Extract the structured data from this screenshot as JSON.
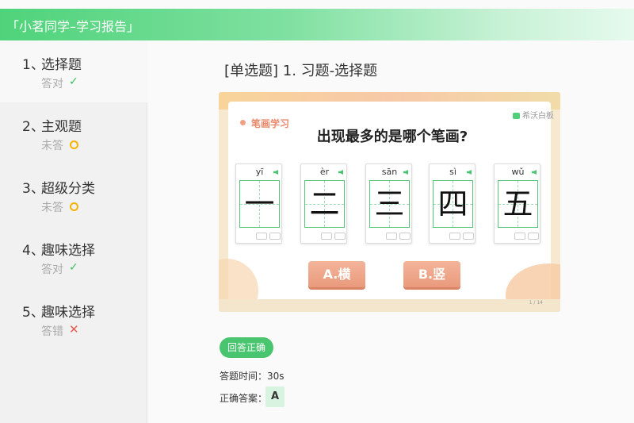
{
  "header": {
    "title": "「小茗同学–学习报告」"
  },
  "sidebar": {
    "items": [
      {
        "num": "1、",
        "title": "选择题",
        "status": "答对",
        "icon": "✓",
        "icon_type": "check-icon"
      },
      {
        "num": "2、",
        "title": "主观题",
        "status": "未答",
        "icon": "",
        "icon_type": "circle-icon"
      },
      {
        "num": "3、",
        "title": "超级分类",
        "status": "未答",
        "icon": "",
        "icon_type": "circle-icon"
      },
      {
        "num": "4、",
        "title": "趣味选择",
        "status": "答对",
        "icon": "✓",
        "icon_type": "check-icon"
      },
      {
        "num": "5、",
        "title": "趣味选择",
        "status": "答错",
        "icon": "✕",
        "icon_type": "cross-icon"
      }
    ]
  },
  "main": {
    "title": "[单选题] 1. 习题-选择题",
    "slide": {
      "tag": "笔画学习",
      "brand": "希沃白板",
      "question": "出现最多的是哪个笔画?",
      "cards": [
        {
          "pinyin": "yī",
          "char": "一"
        },
        {
          "pinyin": "èr",
          "char": "二"
        },
        {
          "pinyin": "sān",
          "char": "三"
        },
        {
          "pinyin": "sì",
          "char": "四"
        },
        {
          "pinyin": "wǔ",
          "char": "五"
        }
      ],
      "options": [
        "A.横",
        "B.竖"
      ],
      "page_indicator": "1 / 14"
    },
    "result": "回答正确",
    "time_label": "答题时间：30s",
    "answer_label": "正确答案：",
    "answer_value": "A"
  },
  "colors": {
    "accent": "#49c46f",
    "header_start": "#4fd37a",
    "option": "#ea9a7c",
    "wrong": "#e85a4f",
    "pending": "#f5b300"
  }
}
